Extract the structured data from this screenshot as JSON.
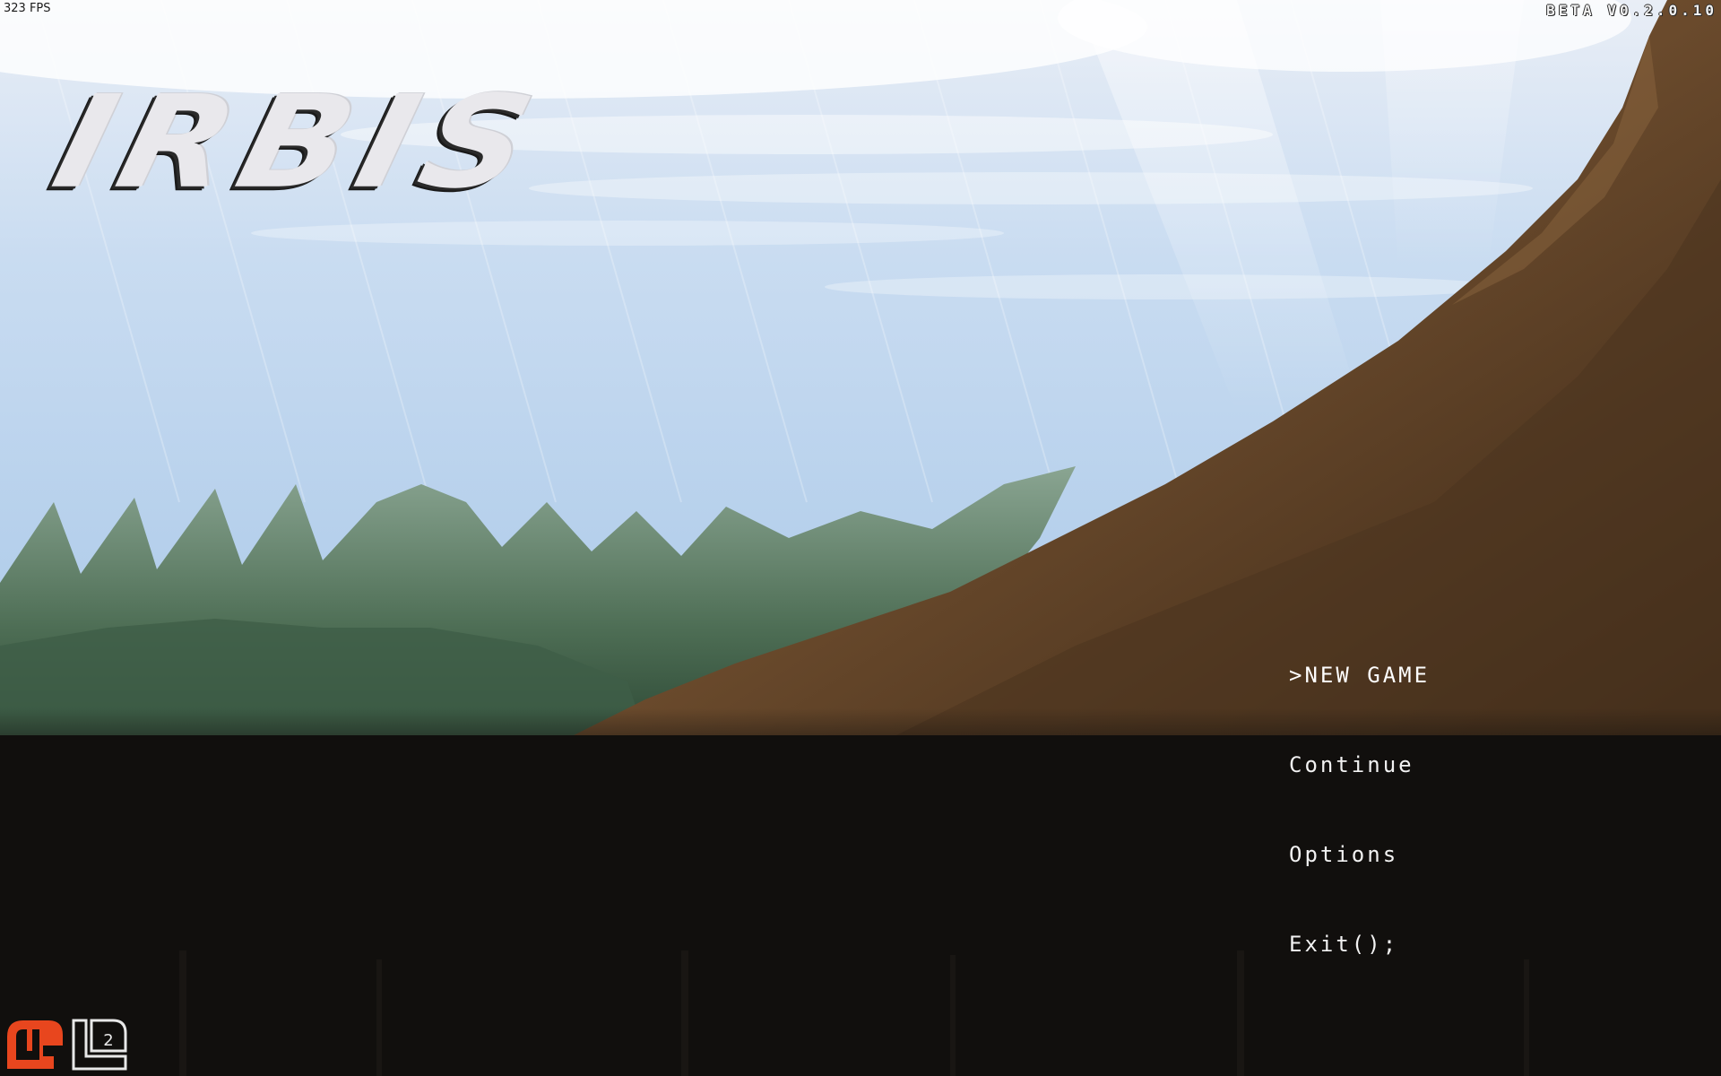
{
  "hud": {
    "fps": "323 FPS",
    "version": "BETA V0.2.0.10"
  },
  "game": {
    "title": "IRBIS"
  },
  "menu": {
    "items": [
      {
        "label": ">NEW GAME",
        "selected": true
      },
      {
        "label": "Continue",
        "selected": false
      },
      {
        "label": "Options",
        "selected": false
      },
      {
        "label": "Exit();",
        "selected": false
      }
    ]
  },
  "colors": {
    "sky": "#c8dcf2",
    "grass": "#4e6e55",
    "cliff": "#6a4a2c",
    "ground": "#110f0d",
    "menu_text": "#f2f2f2",
    "logo_orange": "#e8461e"
  },
  "icons": {
    "engine_logo": "monogame-logo-icon"
  }
}
